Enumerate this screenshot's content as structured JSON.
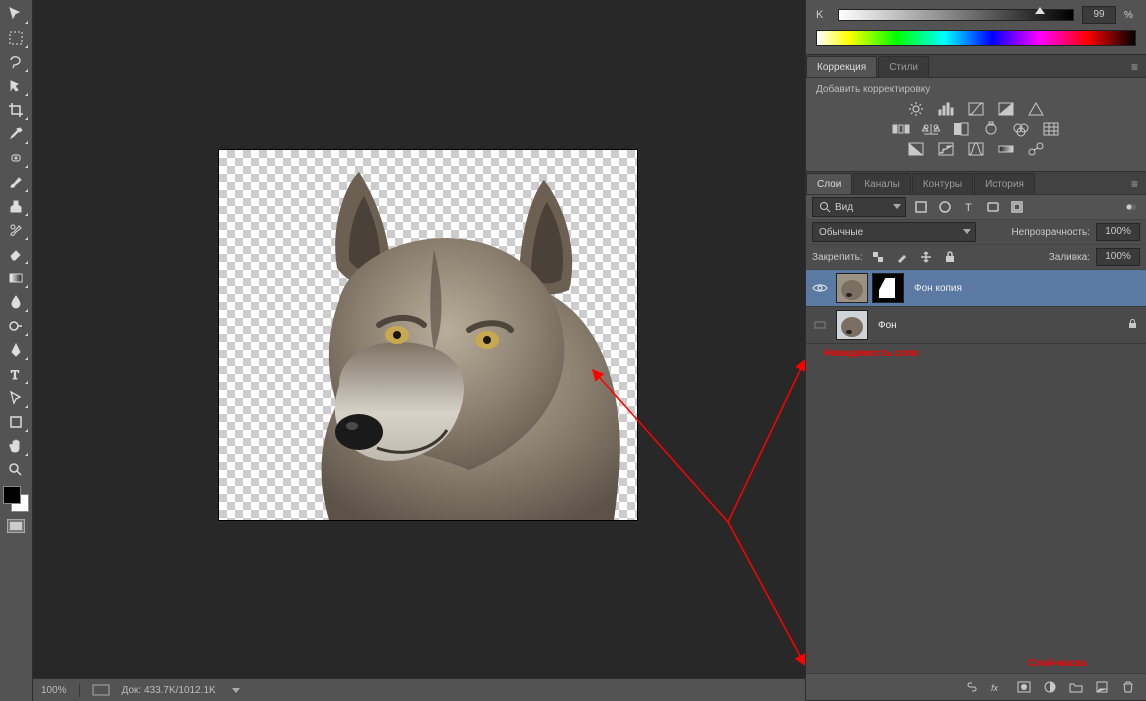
{
  "color_panel": {
    "channel": "K",
    "value": "99",
    "unit": "%"
  },
  "adjustments_panel": {
    "tabs": [
      "Коррекция",
      "Стили"
    ],
    "subtitle": "Добавить корректировку"
  },
  "layers_panel": {
    "tabs": [
      "Слои",
      "Каналы",
      "Контуры",
      "История"
    ],
    "filter_label": "Вид",
    "blend_mode": "Обычные",
    "opacity_label": "Непрозрачность:",
    "opacity_value": "100%",
    "lock_label": "Закрепить:",
    "fill_label": "Заливка:",
    "fill_value": "100%",
    "layers": [
      {
        "name": "Фон копия",
        "visible": true,
        "selected": true,
        "has_mask": true
      },
      {
        "name": "Фон",
        "visible": false,
        "selected": false,
        "has_mask": false,
        "locked": true
      }
    ]
  },
  "annotations": {
    "anno1": "Невидимость слоя",
    "anno2": "Слой-маска"
  },
  "statusbar": {
    "zoom": "100%",
    "doc_info": "Док: 433.7K/1012.1K"
  }
}
